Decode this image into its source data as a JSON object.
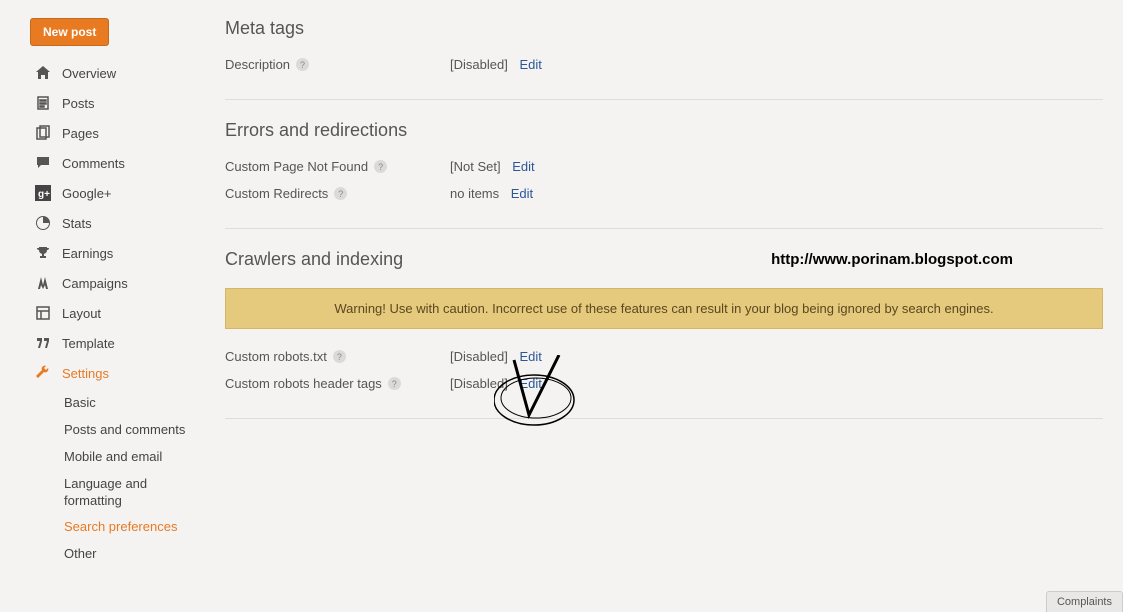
{
  "sidebar": {
    "new_post": "New post",
    "items": [
      {
        "label": "Overview"
      },
      {
        "label": "Posts"
      },
      {
        "label": "Pages"
      },
      {
        "label": "Comments"
      },
      {
        "label": "Google+"
      },
      {
        "label": "Stats"
      },
      {
        "label": "Earnings"
      },
      {
        "label": "Campaigns"
      },
      {
        "label": "Layout"
      },
      {
        "label": "Template"
      },
      {
        "label": "Settings"
      }
    ],
    "sub_items": [
      {
        "label": "Basic"
      },
      {
        "label": "Posts and comments"
      },
      {
        "label": "Mobile and email"
      },
      {
        "label": "Language and formatting"
      },
      {
        "label": "Search preferences"
      },
      {
        "label": "Other"
      }
    ]
  },
  "sections": {
    "meta": {
      "title": "Meta tags",
      "description_label": "Description",
      "description_value": "[Disabled]",
      "edit": "Edit"
    },
    "errors": {
      "title": "Errors and redirections",
      "not_found_label": "Custom Page Not Found",
      "not_found_value": "[Not Set]",
      "redirects_label": "Custom Redirects",
      "redirects_value": "no items",
      "edit": "Edit"
    },
    "crawlers": {
      "title": "Crawlers and indexing",
      "url": "http://www.porinam.blogspot.com",
      "warning": "Warning! Use with caution. Incorrect use of these features can result in your blog being ignored by search engines.",
      "robots_txt_label": "Custom robots.txt",
      "robots_txt_value": "[Disabled]",
      "header_tags_label": "Custom robots header tags",
      "header_tags_value": "[Disabled]",
      "edit": "Edit"
    }
  },
  "footer": {
    "complaints": "Complaints"
  }
}
